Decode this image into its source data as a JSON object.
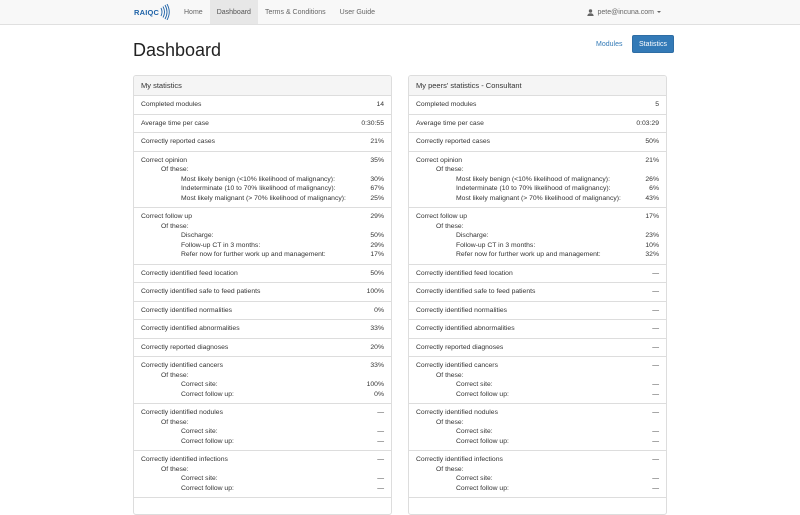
{
  "navbar": {
    "brand": "RAIQC",
    "links": [
      {
        "label": "Home",
        "active": false
      },
      {
        "label": "Dashboard",
        "active": true
      },
      {
        "label": "Terms & Conditions",
        "active": false
      },
      {
        "label": "User Guide",
        "active": false
      }
    ],
    "user_email": "pete@incuna.com"
  },
  "page": {
    "title": "Dashboard",
    "modules_link": "Modules",
    "statistics_button": "Statistics"
  },
  "colors": {
    "accent": "#337ab7",
    "brand": "#1f63a8"
  },
  "panels": [
    {
      "title": "My statistics",
      "items": [
        {
          "label": "Completed modules",
          "value": "14"
        },
        {
          "label": "Average time per case",
          "value": "0:30:55"
        },
        {
          "label": "Correctly reported cases",
          "value": "21%"
        },
        {
          "label": "Correct opinion",
          "value": "35%",
          "of_these": "Of these:",
          "subs": [
            {
              "label": "Most likely benign (<10% likelihood of malignancy):",
              "value": "30%"
            },
            {
              "label": "Indeterminate (10 to 70% likelihood of malignancy):",
              "value": "67%"
            },
            {
              "label": "Most likely malignant (> 70% likelihood of malignancy):",
              "value": "25%"
            }
          ]
        },
        {
          "label": "Correct follow up",
          "value": "29%",
          "of_these": "Of these:",
          "subs": [
            {
              "label": "Discharge:",
              "value": "50%"
            },
            {
              "label": "Follow-up CT in 3 months:",
              "value": "29%"
            },
            {
              "label": "Refer now for further work up and management:",
              "value": "17%"
            }
          ]
        },
        {
          "label": "Correctly identified feed location",
          "value": "50%"
        },
        {
          "label": "Correctly identified safe to feed patients",
          "value": "100%"
        },
        {
          "label": "Correctly identified normalities",
          "value": "0%"
        },
        {
          "label": "Correctly identified abnormalities",
          "value": "33%"
        },
        {
          "label": "Correctly reported diagnoses",
          "value": "20%"
        },
        {
          "label": "Correctly identified cancers",
          "value": "33%",
          "of_these": "Of these:",
          "subs": [
            {
              "label": "Correct site:",
              "value": "100%"
            },
            {
              "label": "Correct follow up:",
              "value": "0%"
            }
          ]
        },
        {
          "label": "Correctly identified nodules",
          "value": "—",
          "of_these": "Of these:",
          "subs": [
            {
              "label": "Correct site:",
              "value": "—"
            },
            {
              "label": "Correct follow up:",
              "value": "—"
            }
          ]
        },
        {
          "label": "Correctly identified infections",
          "value": "—",
          "of_these": "Of these:",
          "subs": [
            {
              "label": "Correct site:",
              "value": "—"
            },
            {
              "label": "Correct follow up:",
              "value": "—"
            }
          ]
        }
      ]
    },
    {
      "title": "My peers' statistics - Consultant",
      "items": [
        {
          "label": "Completed modules",
          "value": "5"
        },
        {
          "label": "Average time per case",
          "value": "0:03:29"
        },
        {
          "label": "Correctly reported cases",
          "value": "50%"
        },
        {
          "label": "Correct opinion",
          "value": "21%",
          "of_these": "Of these:",
          "subs": [
            {
              "label": "Most likely benign (<10% likelihood of malignancy):",
              "value": "26%"
            },
            {
              "label": "Indeterminate (10 to 70% likelihood of malignancy):",
              "value": "6%"
            },
            {
              "label": "Most likely malignant (> 70% likelihood of malignancy):",
              "value": "43%"
            }
          ]
        },
        {
          "label": "Correct follow up",
          "value": "17%",
          "of_these": "Of these:",
          "subs": [
            {
              "label": "Discharge:",
              "value": "23%"
            },
            {
              "label": "Follow-up CT in 3 months:",
              "value": "10%"
            },
            {
              "label": "Refer now for further work up and management:",
              "value": "32%"
            }
          ]
        },
        {
          "label": "Correctly identified feed location",
          "value": "—"
        },
        {
          "label": "Correctly identified safe to feed patients",
          "value": "—"
        },
        {
          "label": "Correctly identified normalities",
          "value": "—"
        },
        {
          "label": "Correctly identified abnormalities",
          "value": "—"
        },
        {
          "label": "Correctly reported diagnoses",
          "value": "—"
        },
        {
          "label": "Correctly identified cancers",
          "value": "—",
          "of_these": "Of these:",
          "subs": [
            {
              "label": "Correct site:",
              "value": "—"
            },
            {
              "label": "Correct follow up:",
              "value": "—"
            }
          ]
        },
        {
          "label": "Correctly identified nodules",
          "value": "—",
          "of_these": "Of these:",
          "subs": [
            {
              "label": "Correct site:",
              "value": "—"
            },
            {
              "label": "Correct follow up:",
              "value": "—"
            }
          ]
        },
        {
          "label": "Correctly identified infections",
          "value": "—",
          "of_these": "Of these:",
          "subs": [
            {
              "label": "Correct site:",
              "value": "—"
            },
            {
              "label": "Correct follow up:",
              "value": "—"
            }
          ]
        }
      ]
    }
  ]
}
